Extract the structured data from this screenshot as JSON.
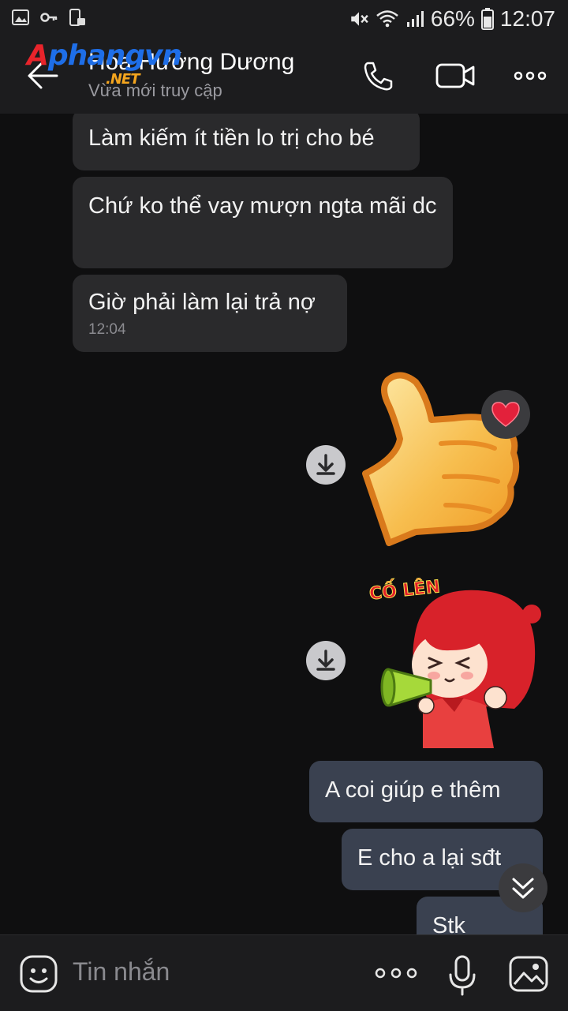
{
  "status_bar": {
    "battery": "66%",
    "time": "12:07"
  },
  "header": {
    "contact_name": "Hoa Hướng Dương",
    "status": "Vừa mới truy cập",
    "watermark": "Aphangvn .NET"
  },
  "messages": [
    {
      "side": "in",
      "text": "Làm kiếm ít tiền lo trị cho bé"
    },
    {
      "side": "in",
      "text": "Chứ ko thể vay mượn ngta mãi dc"
    },
    {
      "side": "in",
      "text": "Giờ phải làm lại trả nợ",
      "time": "12:04"
    },
    {
      "side": "out",
      "type": "sticker",
      "sticker": "thumbs-up",
      "reaction": "heart"
    },
    {
      "side": "out",
      "type": "sticker",
      "sticker": "cheer-girl",
      "caption": "CỐ LÊN"
    },
    {
      "side": "out",
      "text": "A coi giúp e thêm"
    },
    {
      "side": "out",
      "text": "E cho a lại  sđt"
    },
    {
      "side": "out",
      "text": "Stk"
    }
  ],
  "composer": {
    "placeholder": "Tin nhắn"
  },
  "colors": {
    "background": "#0f0f10",
    "bar": "#1c1c1e",
    "incoming_bubble": "#2a2a2c",
    "outgoing_bubble": "#3a4150"
  }
}
